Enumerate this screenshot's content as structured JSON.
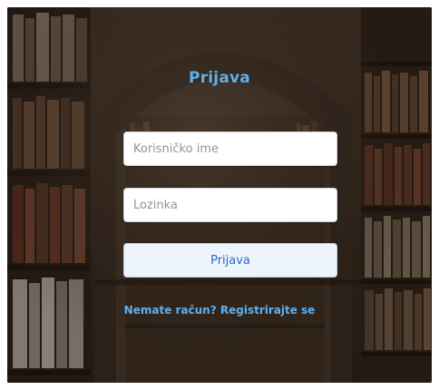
{
  "login": {
    "title": "Prijava",
    "username_placeholder": "Korisničko ime",
    "password_placeholder": "Lozinka",
    "submit_label": "Prijava",
    "register_link": "Nemate račun? Registrirajte se"
  },
  "colors": {
    "accent": "#5fb0ec",
    "button_text": "#2d6bc4",
    "button_bg": "#eef4fd"
  }
}
